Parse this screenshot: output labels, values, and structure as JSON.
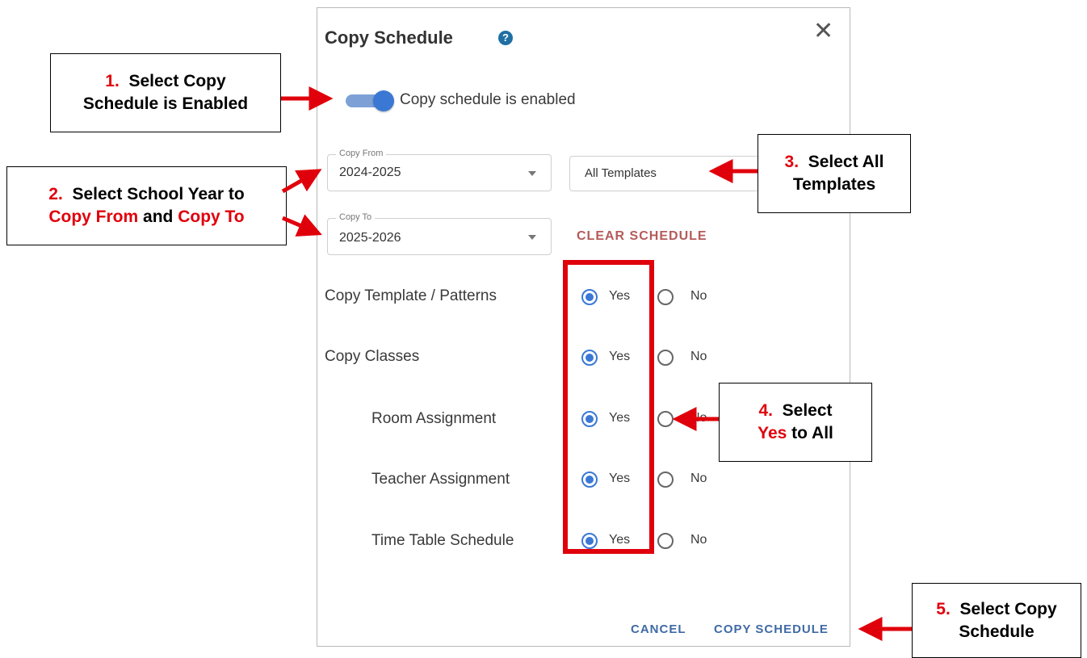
{
  "dialog": {
    "title": "Copy Schedule",
    "help_icon_glyph": "?",
    "close_glyph": "✕",
    "toggle_label": "Copy schedule is enabled",
    "toggle_on": true,
    "copy_from": {
      "label": "Copy From",
      "value": "2024-2025"
    },
    "template_select": {
      "value": "All Templates"
    },
    "copy_to": {
      "label": "Copy To",
      "value": "2025-2026"
    },
    "clear_schedule": "CLEAR SCHEDULE",
    "rows": [
      {
        "label": "Copy Template / Patterns",
        "selected": "Yes"
      },
      {
        "label": "Copy Classes",
        "selected": "Yes"
      },
      {
        "label": "Room Assignment",
        "selected": "Yes"
      },
      {
        "label": "Teacher Assignment",
        "selected": "Yes"
      },
      {
        "label": "Time Table Schedule",
        "selected": "Yes"
      }
    ],
    "yes_label": "Yes",
    "no_label": "No",
    "cancel": "CANCEL",
    "copy_schedule": "COPY SCHEDULE"
  },
  "callouts": {
    "c1": {
      "num": "1.",
      "line1": "Select Copy",
      "line2": "Schedule is Enabled"
    },
    "c2": {
      "num": "2.",
      "line1": "Select School Year to",
      "red1": "Copy From",
      "mid": " and ",
      "red2": "Copy To"
    },
    "c3": {
      "num": "3.",
      "line1": "Select All",
      "line2": "Templates"
    },
    "c4": {
      "num": "4.",
      "line1": "Select",
      "red": "Yes",
      "line2": " to All"
    },
    "c5": {
      "num": "5.",
      "line1": "Select Copy",
      "line2": "Schedule"
    }
  },
  "colors": {
    "accent_blue": "#3a78d4",
    "annotation_red": "#e0000b",
    "clear_link": "#b55a5a"
  }
}
